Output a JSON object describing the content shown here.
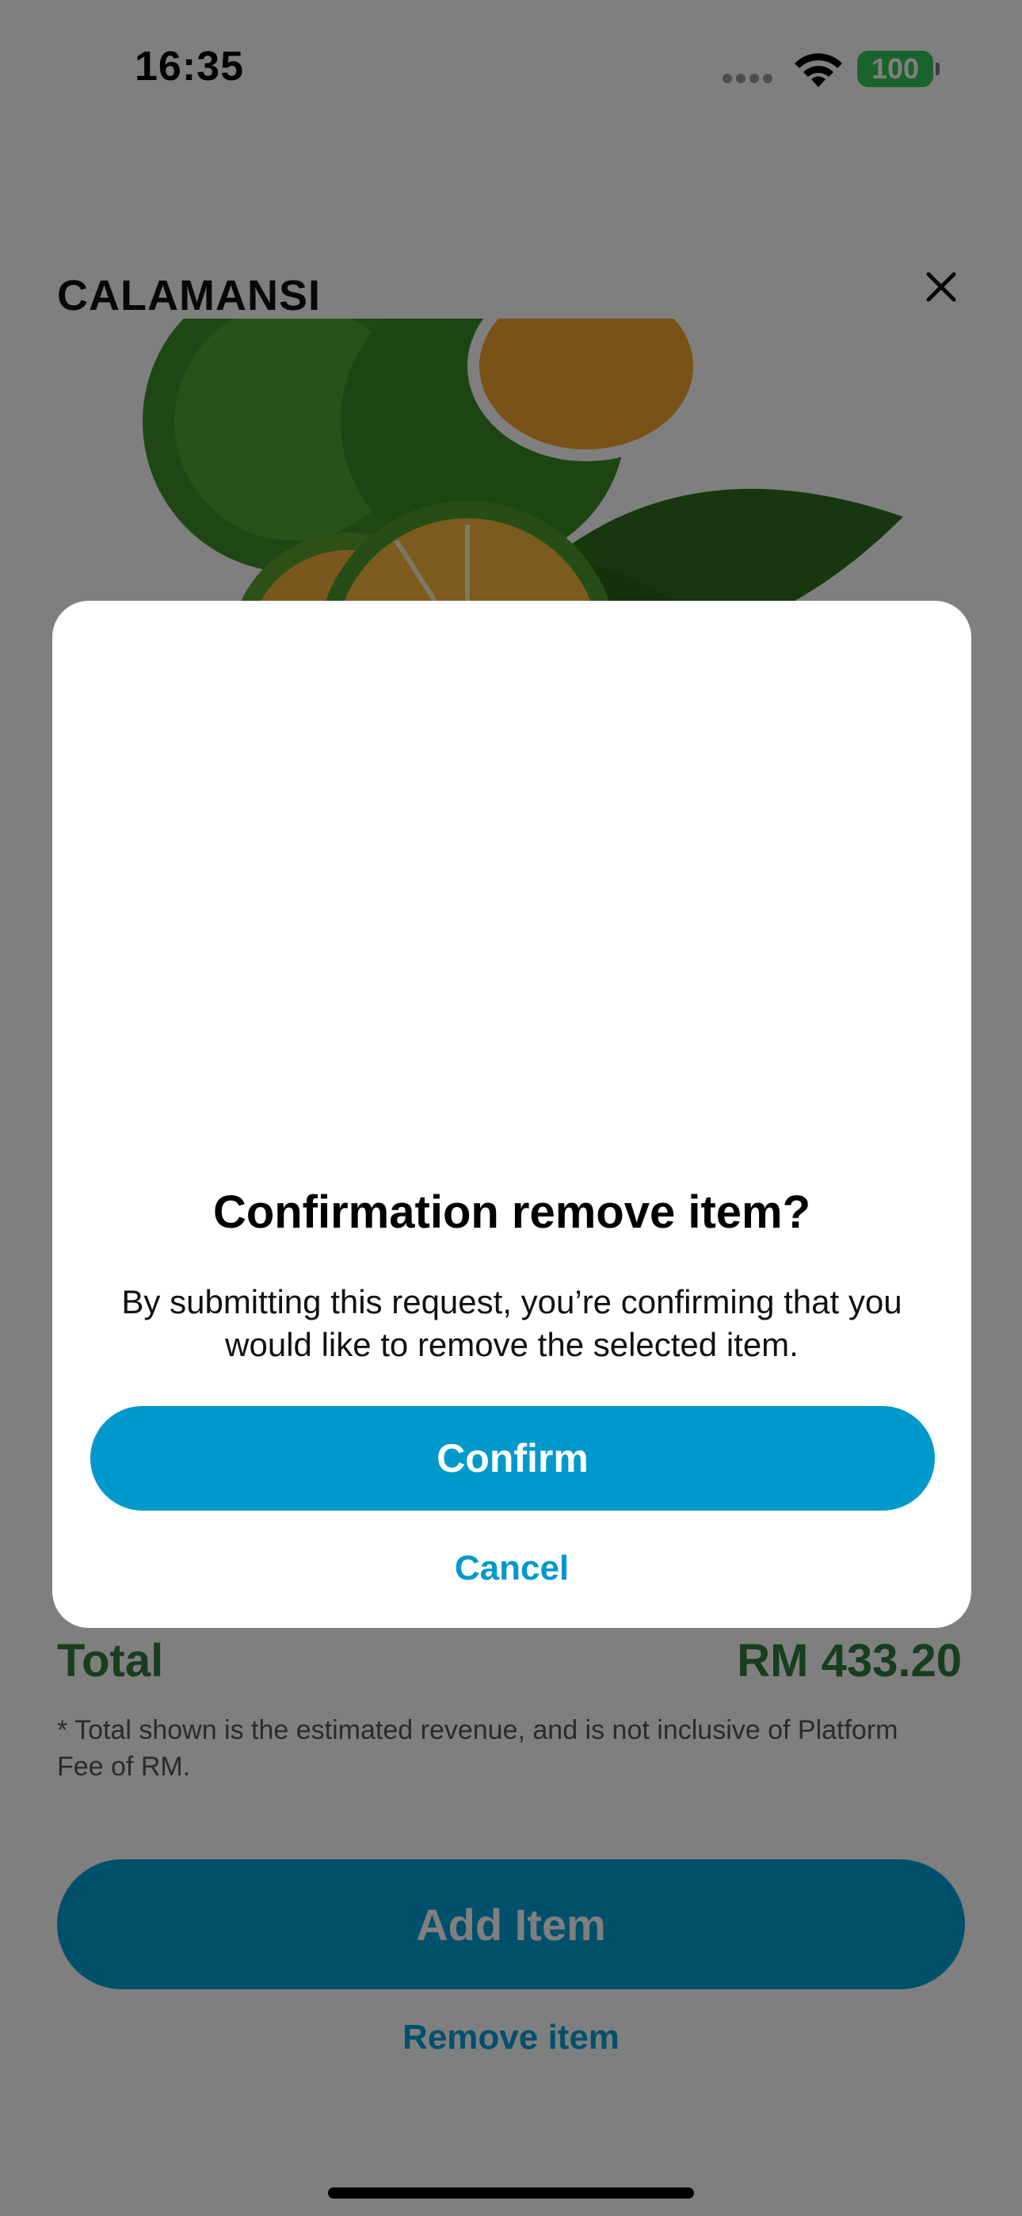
{
  "status_bar": {
    "time": "16:35",
    "battery": "100",
    "battery_color": "#34c759"
  },
  "product": {
    "title": "CALAMANSI",
    "image_icon": "calamansi-fruit-image"
  },
  "summary": {
    "total_label": "Total",
    "total_value": "RM 433.20",
    "note": "* Total shown is the estimated revenue, and is not inclusive of Platform Fee of RM."
  },
  "actions": {
    "add_item_label": "Add Item",
    "remove_item_label": "Remove item"
  },
  "modal": {
    "title": "Confirmation remove item?",
    "body": "By submitting this request, you’re confirming that you would like to remove the selected item.",
    "confirm_label": "Confirm",
    "cancel_label": "Cancel"
  },
  "colors": {
    "accent": "#0099cc",
    "total_green": "#2f7d3c",
    "overlay": "rgba(0,0,0,0.5)"
  }
}
